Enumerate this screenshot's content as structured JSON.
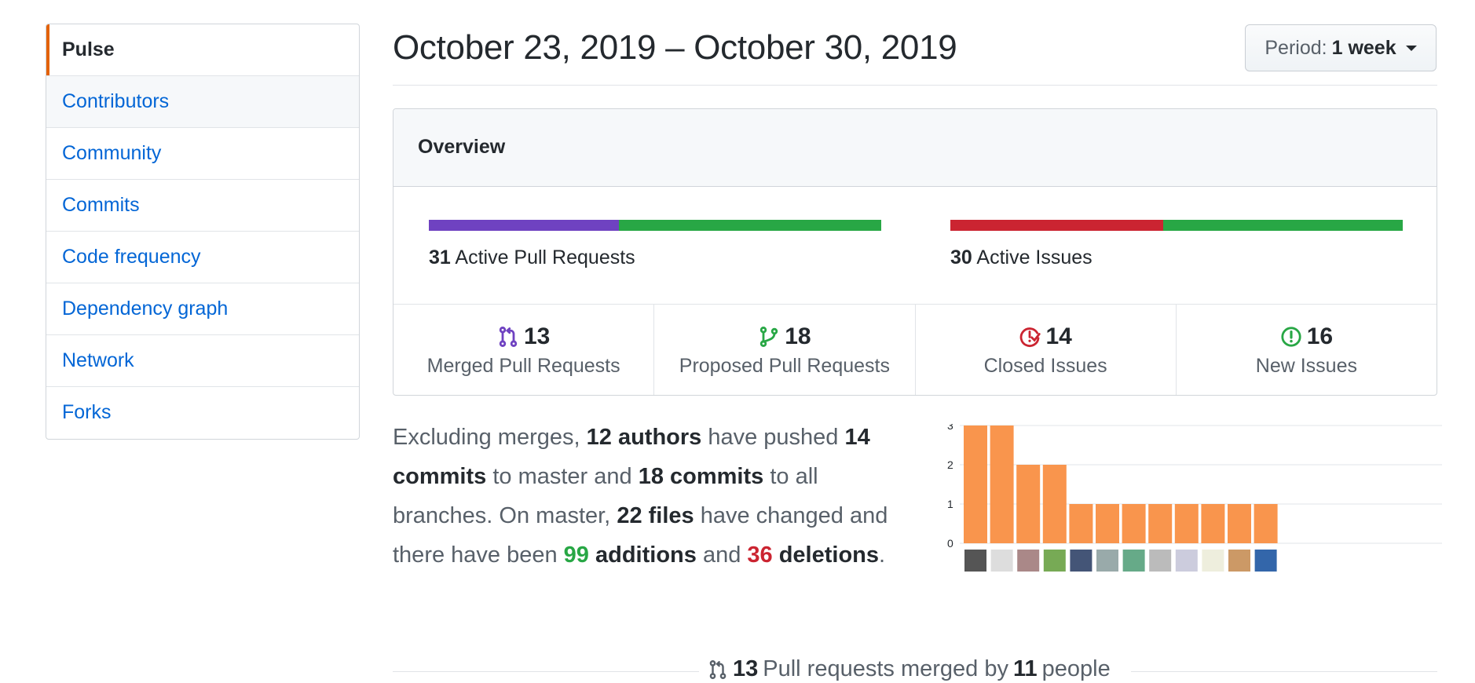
{
  "sidebar": {
    "items": [
      {
        "label": "Pulse"
      },
      {
        "label": "Contributors"
      },
      {
        "label": "Community"
      },
      {
        "label": "Commits"
      },
      {
        "label": "Code frequency"
      },
      {
        "label": "Dependency graph"
      },
      {
        "label": "Network"
      },
      {
        "label": "Forks"
      }
    ]
  },
  "header": {
    "title": "October 23, 2019 – October 30, 2019",
    "period_label": "Period:",
    "period_value": "1 week"
  },
  "overview": {
    "title": "Overview",
    "pull_requests": {
      "count": "31",
      "label": "Active Pull Requests",
      "merged_fraction": 0.42,
      "merged_color": "#6f42c1",
      "open_color": "#28a745"
    },
    "issues": {
      "count": "30",
      "label": "Active Issues",
      "closed_fraction": 0.47,
      "closed_color": "#cb2431",
      "open_color": "#28a745"
    },
    "stats": [
      {
        "icon": "merged-pr-icon",
        "value": "13",
        "label": "Merged Pull Requests",
        "color": "#6f42c1"
      },
      {
        "icon": "open-pr-icon",
        "value": "18",
        "label": "Proposed Pull Requests",
        "color": "#28a745"
      },
      {
        "icon": "closed-issue-icon",
        "value": "14",
        "label": "Closed Issues",
        "color": "#cb2431"
      },
      {
        "icon": "open-issue-icon",
        "value": "16",
        "label": "New Issues",
        "color": "#28a745"
      }
    ]
  },
  "summary": {
    "t1": "Excluding merges, ",
    "authors": "12 authors",
    "t2": " have pushed ",
    "commits_master": "14 commits",
    "t3": " to master and ",
    "commits_all": "18 commits",
    "t4": " to all branches. On master, ",
    "files": "22 files",
    "t5": " have changed and there have been ",
    "additions_num": "99",
    "additions_word": "additions",
    "t6": " and ",
    "deletions_num": "36",
    "deletions_word": "deletions",
    "t7": "."
  },
  "chart_data": {
    "type": "bar",
    "categories": [
      "author-1",
      "author-2",
      "author-3",
      "author-4",
      "author-5",
      "author-6",
      "author-7",
      "author-8",
      "author-9",
      "author-10",
      "author-11",
      "author-12"
    ],
    "values": [
      3,
      3,
      2,
      2,
      1,
      1,
      1,
      1,
      1,
      1,
      1,
      1
    ],
    "ylim": [
      0,
      3
    ],
    "yticks": [
      "0",
      "1",
      "2",
      "3"
    ],
    "bar_color": "#f9954d",
    "grid": true
  },
  "footer": {
    "merged_count": "13",
    "text1": "Pull requests merged by",
    "people_count": "11",
    "text2": "people"
  }
}
